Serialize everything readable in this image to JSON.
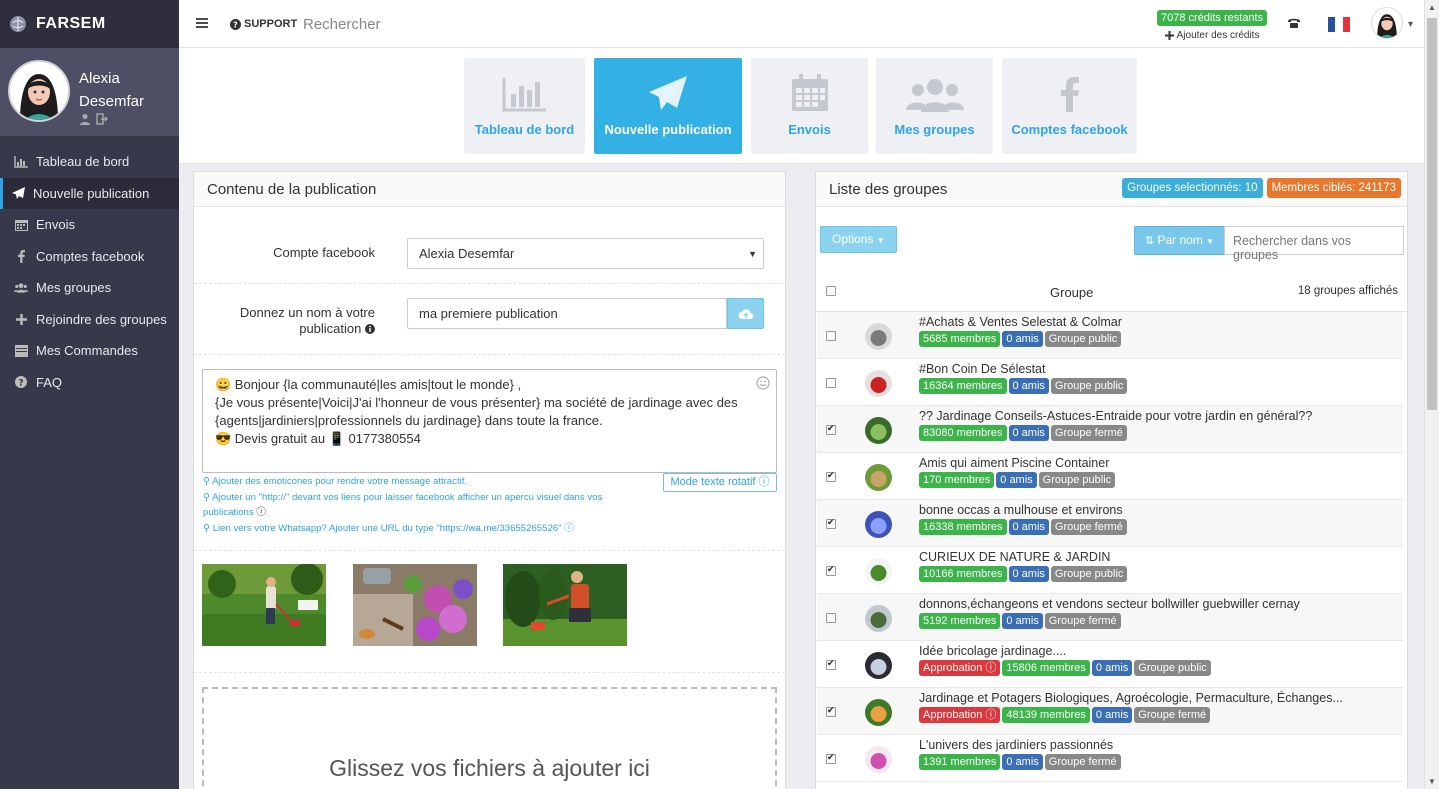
{
  "brand": {
    "name": "FARSEM"
  },
  "user": {
    "first_name": "Alexia",
    "last_name": "Desemfar"
  },
  "sidebar": {
    "items": [
      {
        "label": "Tableau de bord",
        "icon": "chart-icon"
      },
      {
        "label": "Nouvelle publication",
        "icon": "paper-plane-icon",
        "active": true
      },
      {
        "label": "Envois",
        "icon": "calendar-icon"
      },
      {
        "label": "Comptes facebook",
        "icon": "facebook-icon"
      },
      {
        "label": "Mes groupes",
        "icon": "users-icon"
      },
      {
        "label": "Rejoindre des groupes",
        "icon": "plus-icon"
      },
      {
        "label": "Mes Commandes",
        "icon": "list-icon"
      },
      {
        "label": "FAQ",
        "icon": "question-icon"
      }
    ]
  },
  "topbar": {
    "support": "SUPPORT",
    "search_placeholder": "Rechercher",
    "credits": "7078 crédits restants",
    "add_credits": "Ajouter des crédits"
  },
  "tabs": [
    {
      "label": "Tableau de bord",
      "icon": "chart-icon"
    },
    {
      "label": "Nouvelle publication",
      "icon": "paper-plane-icon",
      "active": true
    },
    {
      "label": "Envois",
      "icon": "calendar-icon"
    },
    {
      "label": "Mes groupes",
      "icon": "users-icon"
    },
    {
      "label": "Comptes facebook",
      "icon": "facebook-icon"
    }
  ],
  "left": {
    "title": "Contenu de la publication",
    "account_label": "Compte facebook",
    "account_value": "Alexia Desemfar",
    "name_label_1": "Donnez un nom à votre",
    "name_label_2": "publication",
    "name_value": "ma premiere publication",
    "message": [
      "😀 Bonjour {la communauté|les amis|tout le monde} ,",
      "{Je vous présente|Voici|J'ai l'honneur de vous présenter}  ma société de jardinage avec des {agents|jardiniers|professionnels du jardinage}  dans toute la france.",
      "😎 Devis gratuit au  📱 0177380554"
    ],
    "hint_emoticons": "Ajouter des emoticones pour rendre votre message attractif.",
    "hint_http": "Ajouter un \"http://\" devant vos liens pour laisser facebook afficher un apercu visuel dans vos publications",
    "hint_whatsapp": "Lien vers votre Whatsapp? Ajouter une URL du type \"https://wa.me/33655265526\"",
    "rotating_mode": "Mode texte rotatif",
    "dropzone": "Glissez vos fichiers à ajouter ici"
  },
  "right": {
    "title": "Liste des groupes",
    "selected": "Groupes selectionnés: 10",
    "targeted": "Membres ciblés: 241173",
    "options": "Options",
    "sort": "Par nom",
    "search_placeholder": "Rechercher dans vos groupes",
    "col_group": "Groupe",
    "count": "18 groupes affichés",
    "groups": [
      {
        "name": "#Achats & Ventes Selestat & Colmar",
        "checked": false,
        "labels": [
          {
            "t": "5685 membres",
            "c": "g"
          },
          {
            "t": "0 amis",
            "c": "b"
          },
          {
            "t": "Groupe public",
            "c": "gr"
          }
        ]
      },
      {
        "name": "#Bon Coin De Sélestat",
        "checked": false,
        "labels": [
          {
            "t": "16364 membres",
            "c": "g"
          },
          {
            "t": "0 amis",
            "c": "b"
          },
          {
            "t": "Groupe public",
            "c": "gr"
          }
        ]
      },
      {
        "name": "?? Jardinage Conseils-Astuces-Entraide pour votre jardin en général??",
        "checked": true,
        "labels": [
          {
            "t": "83080 membres",
            "c": "g"
          },
          {
            "t": "0 amis",
            "c": "b"
          },
          {
            "t": "Groupe fermé",
            "c": "gr"
          }
        ]
      },
      {
        "name": "Amis qui aiment Piscine Container",
        "checked": true,
        "labels": [
          {
            "t": "170 membres",
            "c": "g"
          },
          {
            "t": "0 amis",
            "c": "b"
          },
          {
            "t": "Groupe public",
            "c": "gr"
          }
        ]
      },
      {
        "name": "bonne occas a mulhouse et environs",
        "checked": true,
        "labels": [
          {
            "t": "16338 membres",
            "c": "g"
          },
          {
            "t": "0 amis",
            "c": "b"
          },
          {
            "t": "Groupe fermé",
            "c": "gr"
          }
        ]
      },
      {
        "name": "CURIEUX DE NATURE & JARDIN",
        "checked": true,
        "labels": [
          {
            "t": "10166 membres",
            "c": "g"
          },
          {
            "t": "0 amis",
            "c": "b"
          },
          {
            "t": "Groupe public",
            "c": "gr"
          }
        ]
      },
      {
        "name": "donnons,échangeons et vendons secteur bollwiller guebwiller cernay",
        "checked": false,
        "labels": [
          {
            "t": "5192 membres",
            "c": "g"
          },
          {
            "t": "0 amis",
            "c": "b"
          },
          {
            "t": "Groupe fermé",
            "c": "gr"
          }
        ]
      },
      {
        "name": "Idée bricolage jardinage....",
        "checked": true,
        "labels": [
          {
            "t": "Approbation",
            "c": "r",
            "info": true
          },
          {
            "t": "15806 membres",
            "c": "g"
          },
          {
            "t": "0 amis",
            "c": "b"
          },
          {
            "t": "Groupe public",
            "c": "gr"
          }
        ]
      },
      {
        "name": "Jardinage et Potagers Biologiques, Agroécologie, Permaculture, Échanges...",
        "checked": true,
        "labels": [
          {
            "t": "Approbation",
            "c": "r",
            "info": true
          },
          {
            "t": "48139 membres",
            "c": "g"
          },
          {
            "t": "0 amis",
            "c": "b"
          },
          {
            "t": "Groupe fermé",
            "c": "gr"
          }
        ]
      },
      {
        "name": "L'univers des jardiniers passionnés",
        "checked": true,
        "labels": [
          {
            "t": "1391 membres",
            "c": "g"
          },
          {
            "t": "0 amis",
            "c": "b"
          },
          {
            "t": "Groupe fermé",
            "c": "gr"
          }
        ]
      }
    ]
  },
  "colors": {
    "accent": "#33b1e5",
    "sidebar": "#38384b",
    "green": "#3bb54a",
    "blue": "#3a6fb5",
    "gray": "#888888",
    "red": "#d9393e",
    "orange": "#e8772e"
  }
}
